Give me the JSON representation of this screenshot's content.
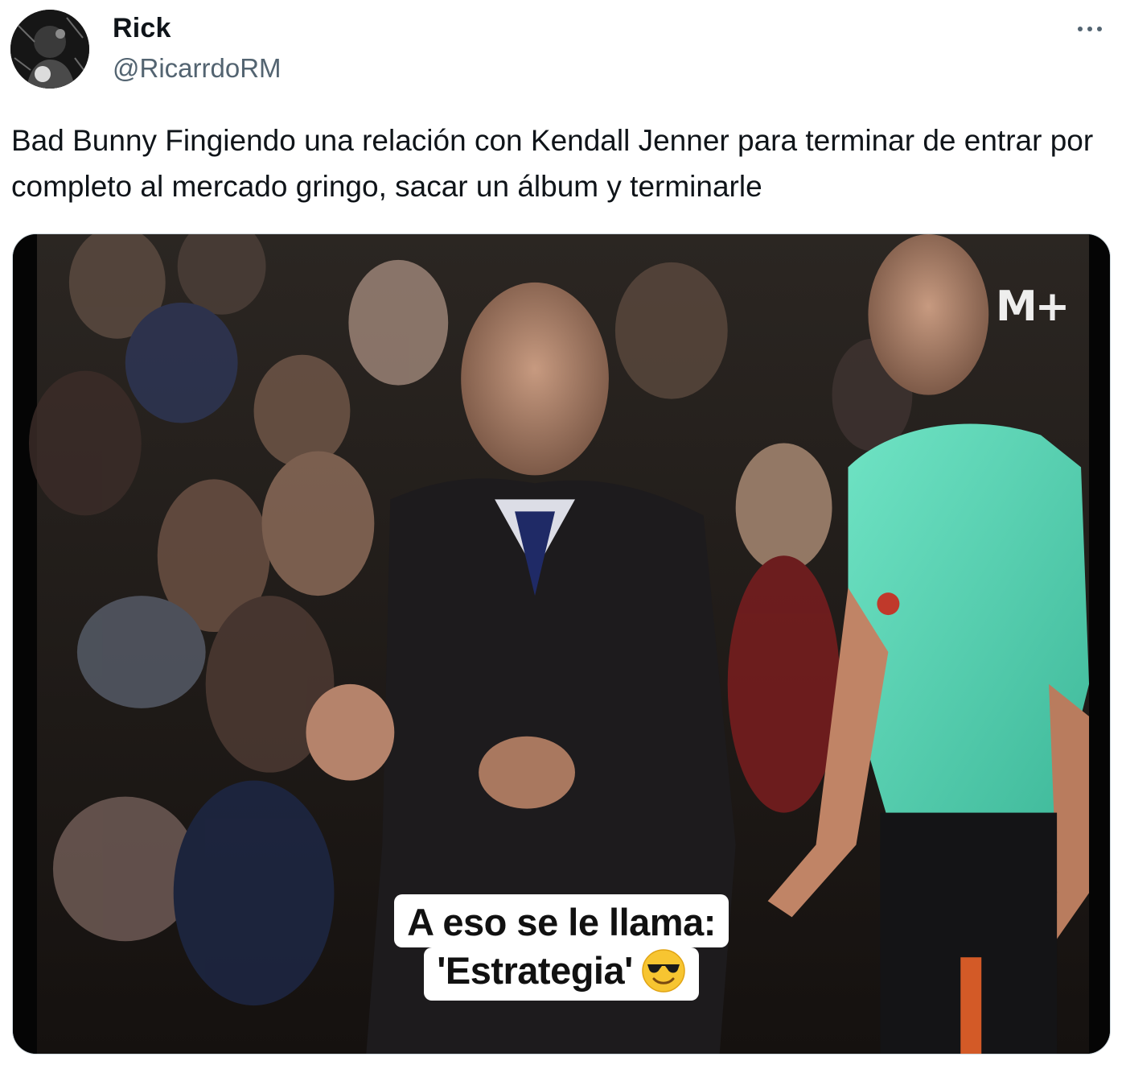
{
  "tweet": {
    "author": {
      "display_name": "Rick",
      "handle": "@RicarrdoRM"
    },
    "more_icon": "more-horizontal-icon",
    "text": "Bad Bunny Fingiendo una relación con Kendall Jenner para terminar de entrar por completo al mercado gringo, sacar un álbum y terminarle",
    "media": {
      "type": "video-frame",
      "caption_line1": "A eso se le llama:",
      "caption_line2": "'Estrategia'",
      "caption_emoji": "smiling-face-with-sunglasses-icon",
      "watermark": "M+"
    }
  }
}
